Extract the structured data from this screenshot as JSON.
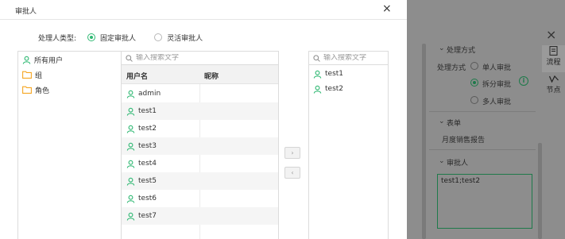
{
  "dialog": {
    "title": "审批人",
    "close_icon": "×",
    "handler_type_label": "处理人类型:",
    "handler_types": [
      {
        "label": "固定审批人",
        "selected": true
      },
      {
        "label": "灵活审批人",
        "selected": false
      }
    ],
    "tree": {
      "all_users": "所有用户",
      "group": "组",
      "role": "角色"
    },
    "user_list": {
      "search_placeholder": "输入搜索文字",
      "col_username": "用户名",
      "col_nickname": "昵称",
      "rows": [
        "admin",
        "test1",
        "test2",
        "test3",
        "test4",
        "test5",
        "test6",
        "test7"
      ]
    },
    "move_right": "›",
    "move_left": "‹",
    "selected": {
      "search_placeholder": "输入搜索文字",
      "items": [
        "test1",
        "test2"
      ]
    }
  },
  "sidebar": {
    "close_icon": "×",
    "section_method": "处理方式",
    "method_label": "处理方式",
    "methods": [
      {
        "label": "单人审批",
        "selected": false
      },
      {
        "label": "拆分审批",
        "selected": true
      },
      {
        "label": "多人审批",
        "selected": false
      }
    ],
    "section_form": "表单",
    "form_name": "月度销售报告",
    "section_approver": "审批人",
    "approver_value": "test1;test2",
    "tabs": [
      "流程",
      "节点"
    ]
  },
  "colors": {
    "accent": "#2eb872",
    "folder": "#f5a623"
  }
}
